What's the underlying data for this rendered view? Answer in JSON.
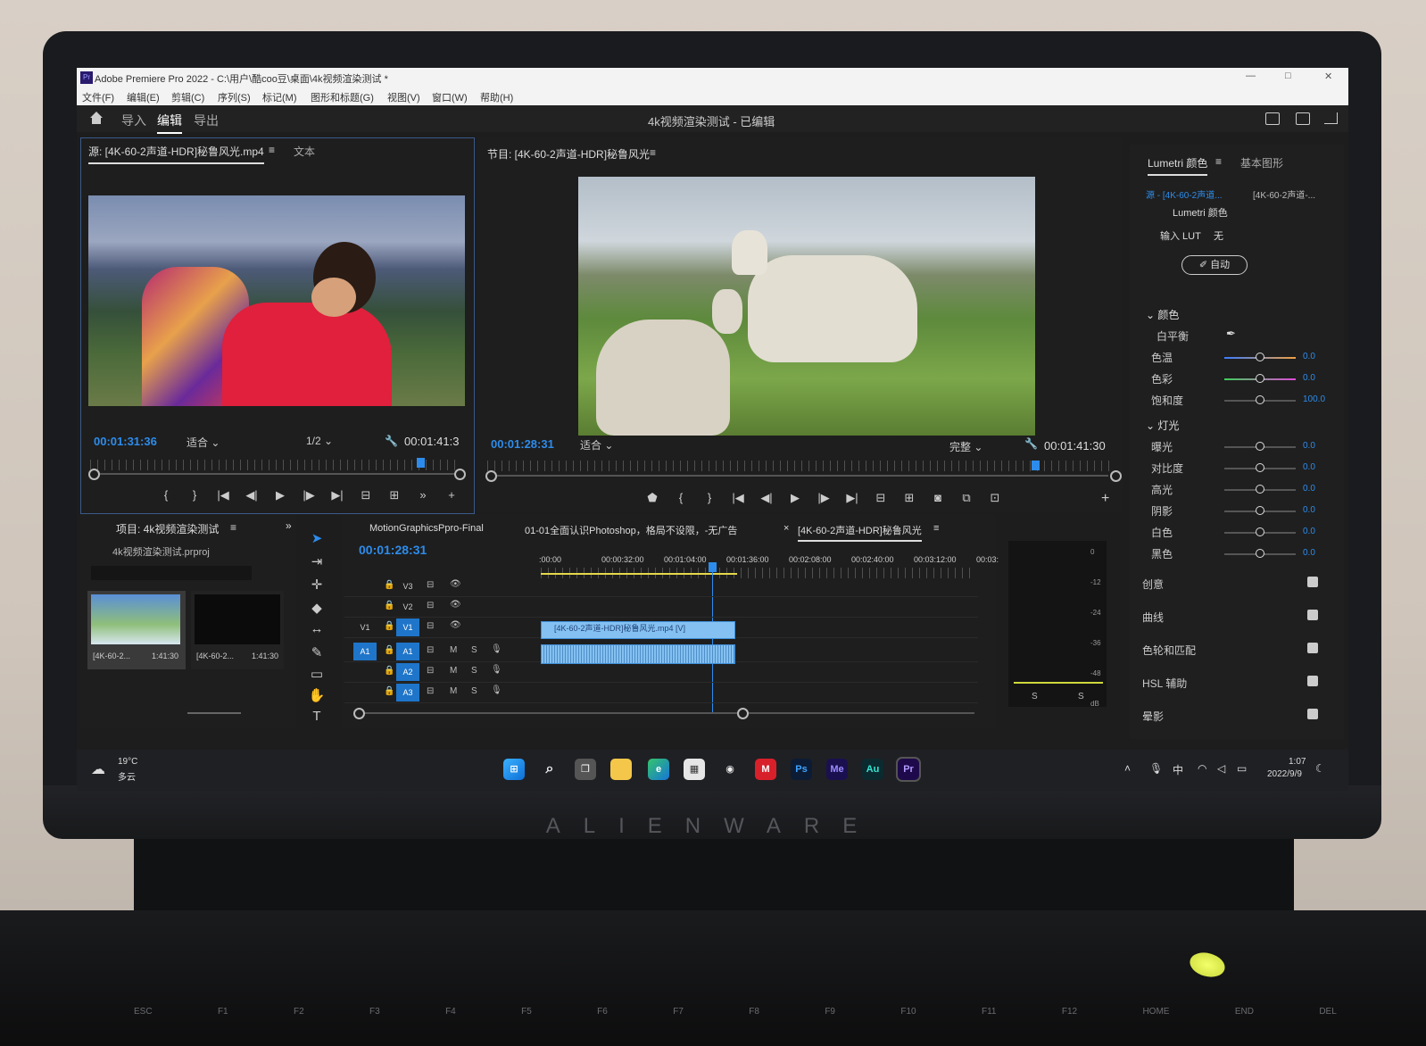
{
  "window": {
    "title": "Adobe Premiere Pro 2022 - C:\\用户\\酷coo豆\\桌面\\4k视频渲染测试 *",
    "minimize": "—",
    "maximize": "□",
    "close": "✕"
  },
  "menu": [
    "文件(F)",
    "编辑(E)",
    "剪辑(C)",
    "序列(S)",
    "标记(M)",
    "图形和标题(G)",
    "视图(V)",
    "窗口(W)",
    "帮助(H)"
  ],
  "workspace": {
    "tabs": [
      "导入",
      "编辑",
      "导出"
    ],
    "active_tab": "编辑",
    "project_title": "4k视频渲染测试 - 已编辑"
  },
  "source_monitor": {
    "tab_label": "源: [4K-60-2声道-HDR]秘鲁风光.mp4",
    "menu_icon": "≡",
    "second_tab": "文本",
    "timecode_in": "00:01:31:36",
    "fit": "适合",
    "resolution": "1/2",
    "duration": "00:01:41:3"
  },
  "program_monitor": {
    "tab_label": "节目: [4K-60-2声道-HDR]秘鲁风光",
    "menu_icon": "≡",
    "timecode": "00:01:28:31",
    "fit": "适合",
    "quality": "完整",
    "duration": "00:01:41:30"
  },
  "project_panel": {
    "tab_label": "项目: 4k视频渲染测试",
    "menu_icon": "≡",
    "file": "4k视频渲染测试.prproj",
    "items": [
      {
        "name": "[4K-60-2...",
        "duration": "1:41:30"
      },
      {
        "name": "[4K-60-2...",
        "duration": "1:41:30"
      }
    ]
  },
  "timeline": {
    "tabs": [
      "MotionGraphicsPpro-Final",
      "01-01全面认识Photoshop，格局不设限，-无广告",
      "[4K-60-2声道-HDR]秘鲁风光"
    ],
    "close_icon": "×",
    "menu_icon": "≡",
    "timecode": "00:01:28:31",
    "ruler_labels": [
      ":00:00",
      "00:00:32:00",
      "00:01:04:00",
      "00:01:36:00",
      "00:02:08:00",
      "00:02:40:00",
      "00:03:12:00",
      "00:03:"
    ],
    "tracks": [
      {
        "name": "V3",
        "src": ""
      },
      {
        "name": "V2",
        "src": ""
      },
      {
        "name": "V1",
        "src": "V1"
      },
      {
        "name": "A1",
        "src": "A1"
      },
      {
        "name": "A2",
        "src": ""
      },
      {
        "name": "A3",
        "src": ""
      }
    ],
    "video_clip": "[4K-60-2声道-HDR]秘鲁风光.mp4 [V]",
    "mute_label": "M",
    "solo_label": "S"
  },
  "meter": {
    "scale": [
      "0",
      "-12",
      "-24",
      "-36",
      "-48",
      "dB"
    ],
    "solo": [
      "S",
      "S"
    ]
  },
  "lumetri": {
    "tabs": [
      "Lumetri 颜色",
      "基本图形"
    ],
    "menu_icon": "≡",
    "source_label": "源 - [4K-60-2声道...",
    "target_label": "[4K-60-2声道-...",
    "fx_name": "Lumetri 颜色",
    "input_lut_label": "输入 LUT",
    "input_lut_value": "无",
    "auto_button": "自动",
    "sec_color": "颜色",
    "white_balance": "白平衡",
    "sec_light": "灯光",
    "color_rows": [
      {
        "label": "色温",
        "value": "0.0",
        "pos": 0.5
      },
      {
        "label": "色彩",
        "value": "0.0",
        "pos": 0.5
      },
      {
        "label": "饱和度",
        "value": "100.0",
        "pos": 0.5
      }
    ],
    "light_rows": [
      {
        "label": "曝光",
        "value": "0.0",
        "pos": 0.5
      },
      {
        "label": "对比度",
        "value": "0.0",
        "pos": 0.5
      },
      {
        "label": "高光",
        "value": "0.0",
        "pos": 0.5
      },
      {
        "label": "阴影",
        "value": "0.0",
        "pos": 0.5
      },
      {
        "label": "白色",
        "value": "0.0",
        "pos": 0.5
      },
      {
        "label": "黑色",
        "value": "0.0",
        "pos": 0.5
      }
    ],
    "sections": [
      "创意",
      "曲线",
      "色轮和匹配",
      "HSL 辅助",
      "晕影"
    ]
  },
  "taskbar": {
    "weather_temp": "19°C",
    "weather_desc": "多云",
    "apps": [
      "Ps",
      "Me",
      "Au",
      "Pr"
    ],
    "ime": "中",
    "time": "1:07",
    "date": "2022/9/9"
  },
  "brand": "ALIENWARE",
  "keys": [
    "ESC",
    "F1",
    "F2",
    "F3",
    "F4",
    "F5",
    "F6",
    "F7",
    "F8",
    "F9",
    "F10",
    "F11",
    "F12",
    "HOME",
    "END",
    "DEL"
  ],
  "colors": {
    "accent": "#2d8ceb",
    "clip": "#84c1f2",
    "track_on": "#1f75c9"
  }
}
